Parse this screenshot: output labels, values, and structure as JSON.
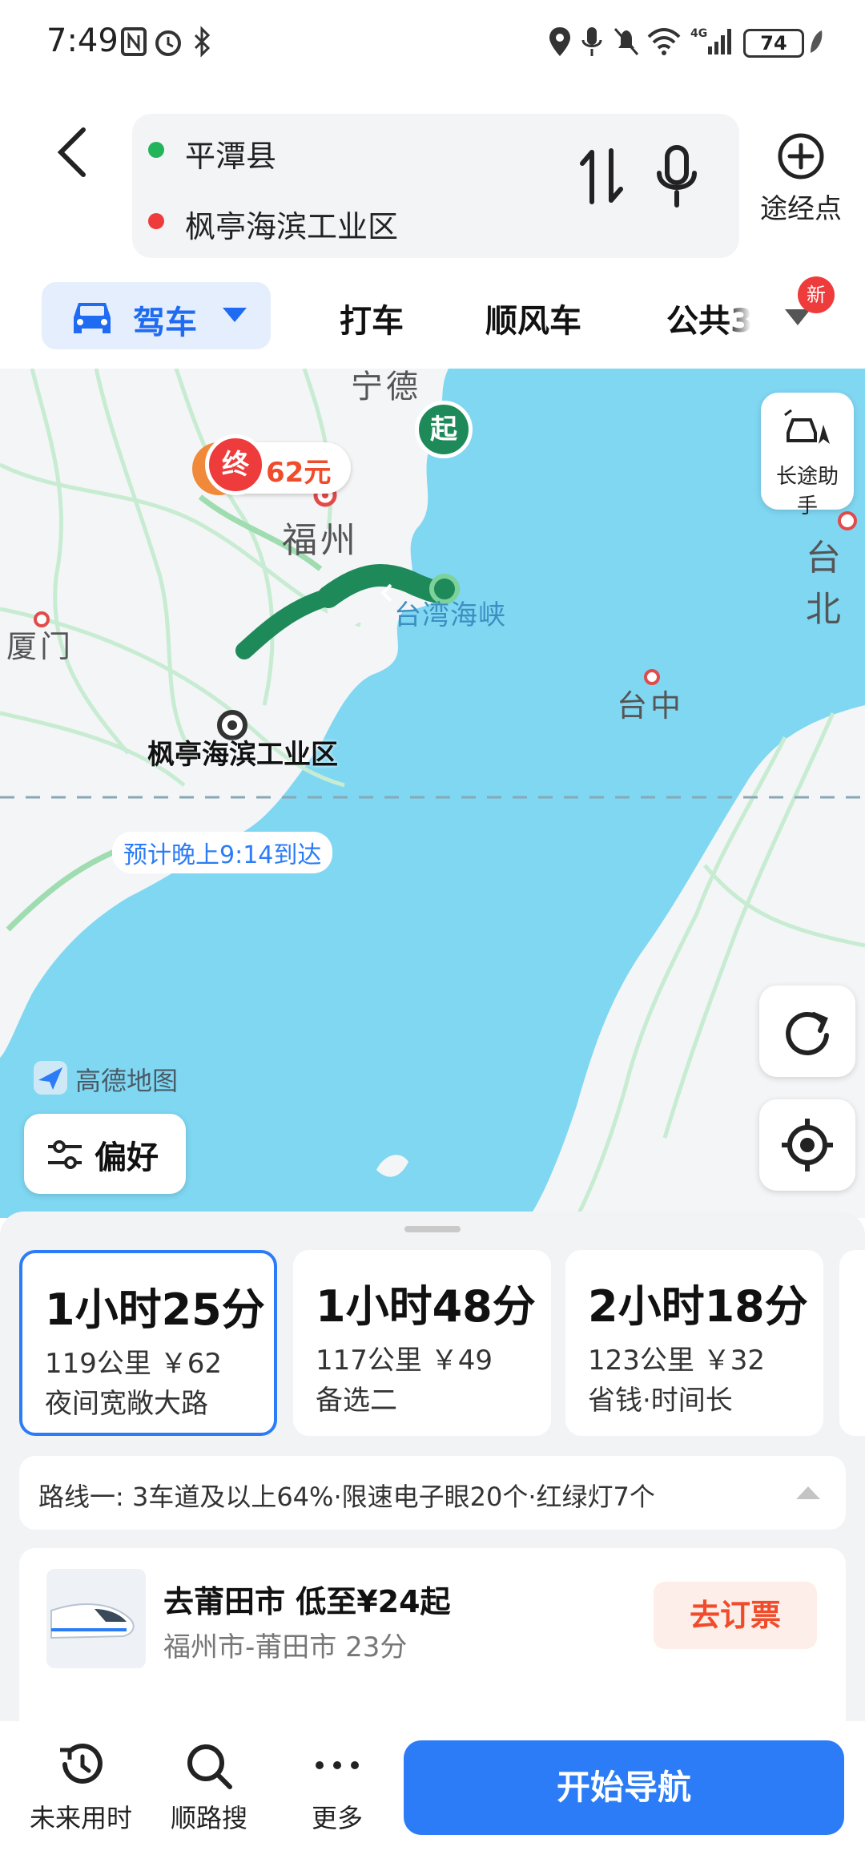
{
  "status_bar": {
    "time": "7:49",
    "battery": "74"
  },
  "route": {
    "origin": "平潭县",
    "destination": "枫亭海滨工业区",
    "waypoint_label": "途经点"
  },
  "mode_tabs": [
    {
      "label": "驾车",
      "selected": true
    },
    {
      "label": "打车"
    },
    {
      "label": "顺风车"
    },
    {
      "label": "公共3"
    }
  ],
  "new_badge": "新",
  "map": {
    "labels": {
      "ningde": "宁德",
      "fuzhou": "福州",
      "xiamen": "厦门",
      "taibei": "台北",
      "taizhong": "台中",
      "strait": "台湾海峡"
    },
    "start_marker": "起",
    "end_marker": "终",
    "toll": "62元",
    "end_name": "枫亭海滨工业区",
    "eta": "预计晚上9:14到达",
    "watermark": "高德地图",
    "long_trip_assistant": "长途助手",
    "preference_button": "偏好"
  },
  "routes": [
    {
      "time": "1小时25分",
      "detail": "119公里  ￥62",
      "tag": "夜间宽敞大路",
      "selected": true
    },
    {
      "time": "1小时48分",
      "detail": "117公里  ￥49",
      "tag": "备选二"
    },
    {
      "time": "2小时18分",
      "detail": "123公里  ￥32",
      "tag": "省钱·时间长"
    }
  ],
  "route_summary": "路线一:   3车道及以上64%·限速电子眼20个·红绿灯7个",
  "promo": {
    "title": "去莆田市 低至¥24起",
    "subtitle": "福州市-莆田市 23分",
    "button": "去订票"
  },
  "bottom_bar": {
    "future_time": "未来用时",
    "along_search": "顺路搜",
    "more": "更多",
    "start_navigation": "开始导航"
  },
  "colors": {
    "accent": "#2b7cf6",
    "route_green": "#1e8a5a",
    "end_red": "#ee3b3b",
    "sea": "#7fd7f2"
  }
}
